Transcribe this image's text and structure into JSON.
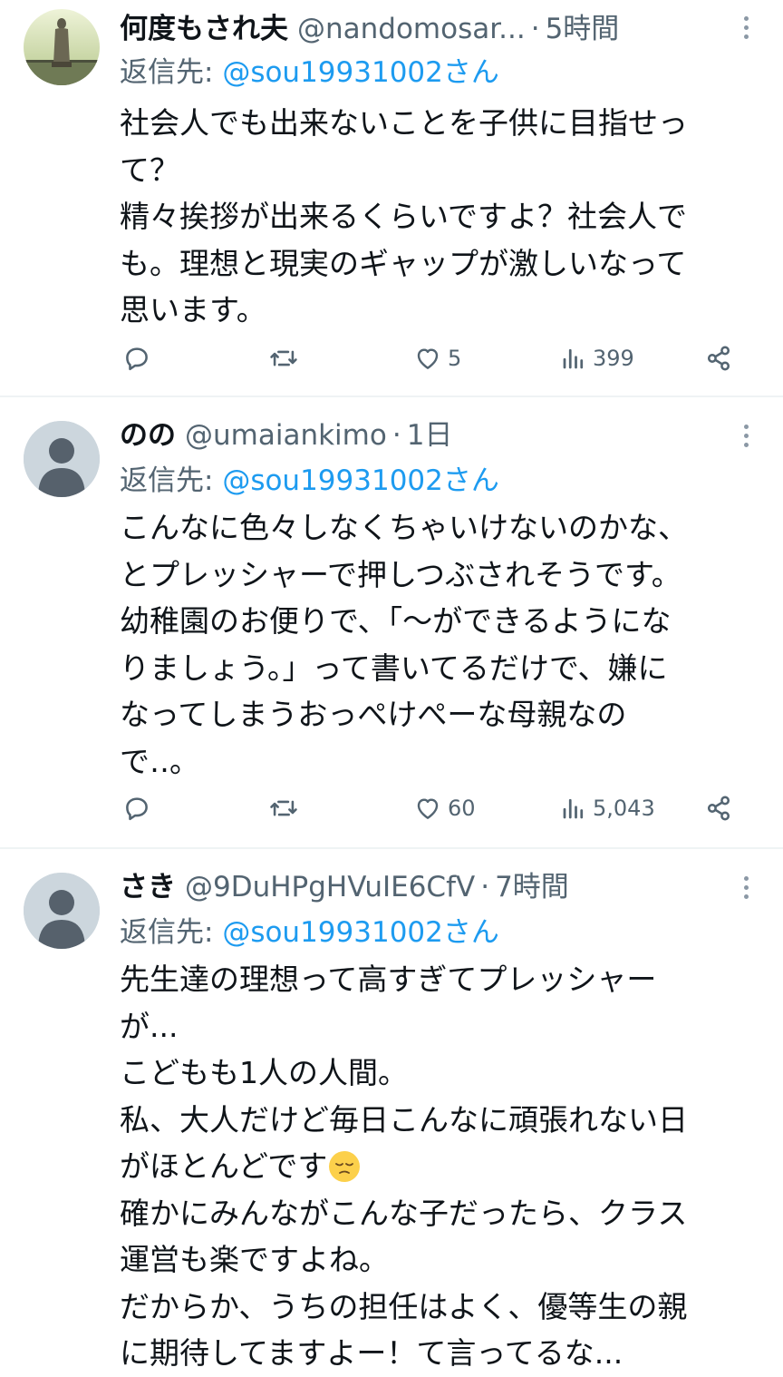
{
  "tweets": [
    {
      "name": "何度もされ夫",
      "handle": "@nandomosar...",
      "time": "5時間",
      "reply_prefix": "返信先: ",
      "reply_to": "@sou19931002さん",
      "lines": [
        "社会人でも出来ないことを子供に目指せっ",
        "て？",
        "精々挨拶が出来るくらいですよ？社会人で",
        "も。理想と現実のギャップが激しいなって",
        "思います。"
      ],
      "likes": "5",
      "views": "399"
    },
    {
      "name": "のの",
      "handle": "@umaiankimo",
      "time": "1日",
      "reply_prefix": "返信先: ",
      "reply_to": "@sou19931002さん",
      "lines": [
        "こんなに色々しなくちゃいけないのかな、",
        "とプレッシャーで押しつぶされそうです。",
        "幼稚園のお便りで、「〜ができるようにな",
        "りましょう。」って書いてるだけで、嫌に",
        "なってしまうおっぺけぺーな母親なの",
        "で‥。"
      ],
      "likes": "60",
      "views": "5,043"
    },
    {
      "name": "さき",
      "handle": "@9DuHPgHVuIE6CfV",
      "time": "7時間",
      "reply_prefix": "返信先: ",
      "reply_to": "@sou19931002さん",
      "lines": [
        "先生達の理想って高すぎてプレッシャー",
        "が...",
        "こどもも1人の人間。",
        "私、大人だけど毎日こんなに頑張れない日",
        "がほとんどです",
        "確かにみんながこんな子だったら、クラス",
        "運営も楽ですよね。",
        "だからか、うちの担任はよく、優等生の親",
        "に期待してますよー！て言ってるな..."
      ],
      "emoji_line_icon": "pensive-face-emoji"
    }
  ],
  "colors": {
    "text": "#0f1419",
    "secondary": "#536471",
    "link": "#1d9bf0",
    "divider": "#eff3f4"
  }
}
